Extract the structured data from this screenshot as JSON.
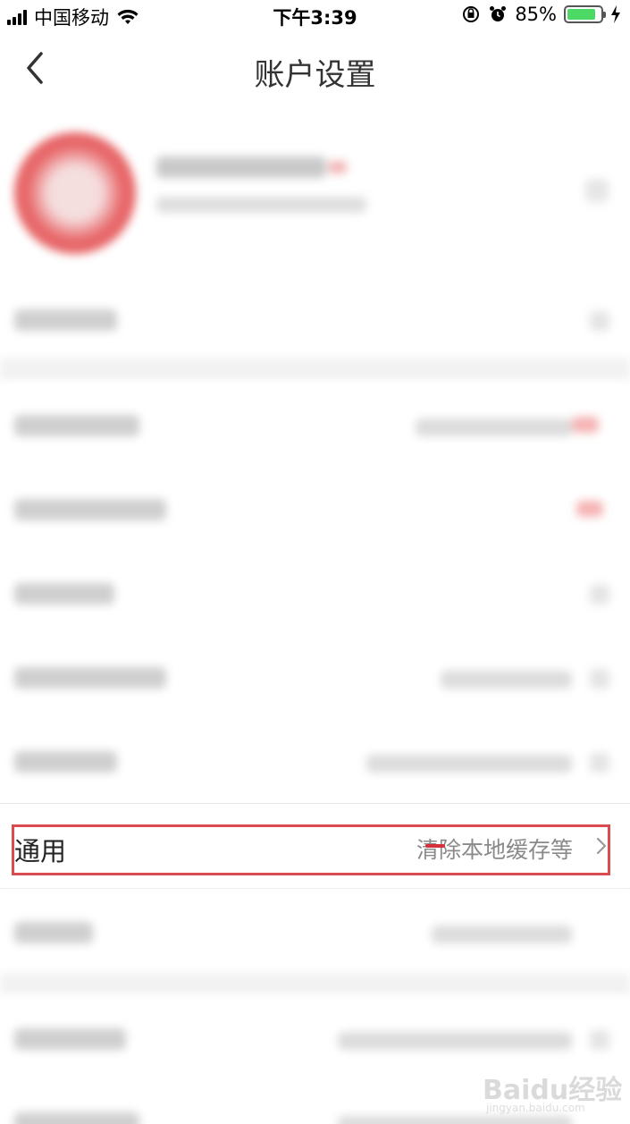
{
  "status_bar": {
    "carrier": "中国移动",
    "time": "下午3:39",
    "battery_percent": "85%",
    "battery_level": 0.85,
    "icons": [
      "signal-icon",
      "wifi-icon",
      "rotation-lock-icon",
      "alarm-icon",
      "battery-icon",
      "charging-icon"
    ]
  },
  "nav": {
    "title": "账户设置",
    "back_icon": "chevron-left-icon"
  },
  "general": {
    "label": "通用",
    "value": "清除本地缓存等",
    "arrow_icon": "chevron-right-icon"
  },
  "watermark": {
    "text": "Baidu经验",
    "url": "jingyan.baidu.com"
  },
  "colors": {
    "highlight": "#d94b4f",
    "battery": "#4cd964",
    "avatar": "#e35658"
  }
}
